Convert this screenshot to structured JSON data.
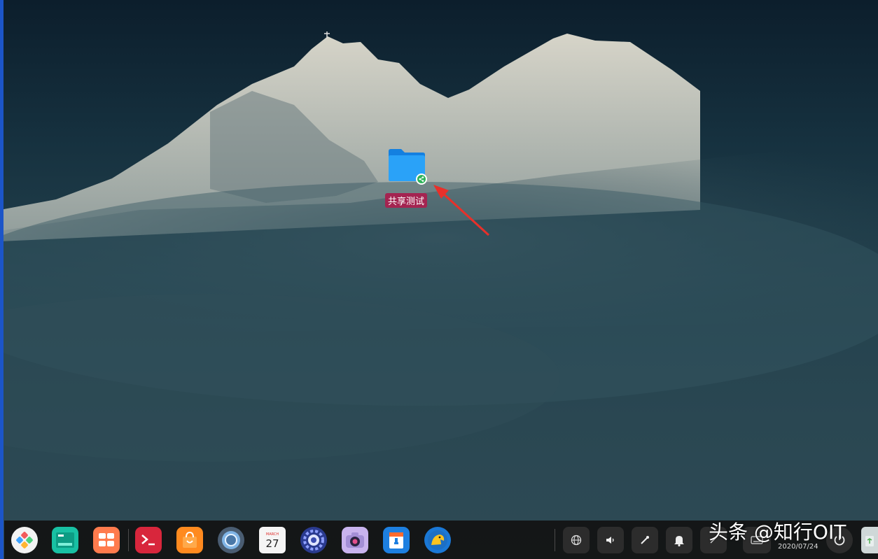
{
  "desktop": {
    "icons": [
      {
        "label": "共享测试",
        "icon": "shared-folder-icon"
      }
    ]
  },
  "dock": {
    "apps": [
      {
        "name": "launcher-icon"
      },
      {
        "name": "file-manager-icon"
      },
      {
        "name": "multitask-view-icon"
      },
      {
        "name": "terminal-icon"
      },
      {
        "name": "app-store-icon"
      },
      {
        "name": "browser-icon"
      },
      {
        "name": "calendar-icon",
        "month": "MARCH",
        "day": "27"
      },
      {
        "name": "settings-icon"
      },
      {
        "name": "camera-icon"
      },
      {
        "name": "archive-manager-icon"
      },
      {
        "name": "game-icon"
      }
    ],
    "tray": [
      {
        "name": "network-icon"
      },
      {
        "name": "volume-icon"
      },
      {
        "name": "brightness-icon"
      },
      {
        "name": "notification-bell-icon"
      },
      {
        "name": "tray-arrow-icon"
      },
      {
        "name": "keyboard-icon"
      }
    ],
    "date": "2020/07/24"
  },
  "watermark": "头条 @知行OIT",
  "colors": {
    "dock_bg": "#121212",
    "label_bg": "#a42451",
    "folder_blue": "#1e90f0",
    "arrow_red": "#e8302a"
  }
}
